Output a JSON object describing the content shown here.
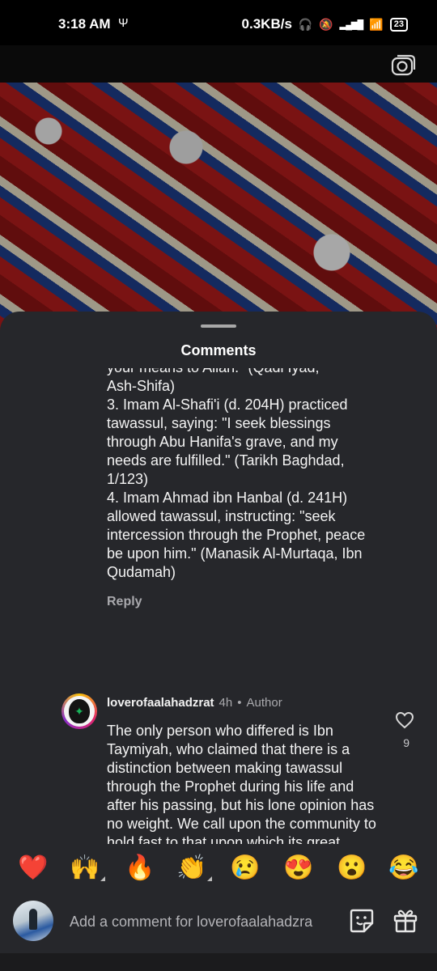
{
  "status_bar": {
    "time": "3:18 AM",
    "usb_glyph": "Ψ",
    "net_speed": "0.3KB/s",
    "headphones_glyph": "🎧",
    "mute_glyph": "🔕",
    "signal_glyph": "▂▄▆█",
    "wifi_glyph": "📶",
    "battery": "23"
  },
  "sheet": {
    "title": "Comments"
  },
  "comments": [
    {
      "text": "your means to Allah.\" (Qadi Iyad,\nAsh-Shifa)\n3. Imam Al-Shafi'i (d. 204H) practiced tawassul, saying: \"I seek blessings through Abu Hanifa's grave, and my needs are fulfilled.\" (Tarikh Baghdad, 1/123)\n4. Imam Ahmad ibn Hanbal (d. 241H) allowed tawassul, instructing: \"seek intercession through the Prophet, peace be upon him.\" (Manasik Al-Murtaqa, Ibn Qudamah)",
      "reply_label": "Reply"
    },
    {
      "username": "loverofaalahadzrat",
      "time": "4h",
      "separator": "•",
      "badge": "Author",
      "text": "The only person who differed is Ibn Taymiyah, who claimed that there is a distinction between making tawassul through the Prophet during his life and after his passing, but his lone opinion has no weight. We call upon the community to hold fast to that upon which its great Imams have agreed. The verse from the Quran that states, And if, when they had wronged",
      "likes": "9"
    }
  ],
  "reactions": [
    "❤️",
    "🙌",
    "🔥",
    "👏",
    "😢",
    "😍",
    "😮",
    "😂"
  ],
  "composer": {
    "placeholder": "Add a comment for loverofaalahadzra"
  },
  "icons": {
    "camera": "camera-icon",
    "heart": "heart-icon",
    "sticker": "sticker-icon",
    "gift": "gift-icon"
  },
  "colors": {
    "sheet_bg": "#26272b",
    "muted_text": "#a9a9ad"
  }
}
